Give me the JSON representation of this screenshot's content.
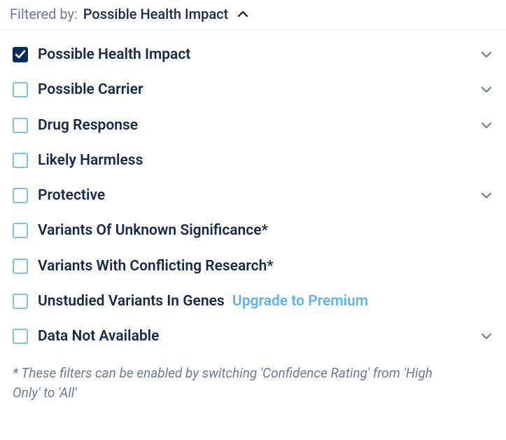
{
  "header": {
    "prefix": "Filtered by:",
    "value": "Possible Health Impact"
  },
  "filters": [
    {
      "label": "Possible Health Impact",
      "checked": true,
      "expandable": true
    },
    {
      "label": "Possible Carrier",
      "checked": false,
      "expandable": true
    },
    {
      "label": "Drug Response",
      "checked": false,
      "expandable": true
    },
    {
      "label": "Likely Harmless",
      "checked": false,
      "expandable": false
    },
    {
      "label": "Protective",
      "checked": false,
      "expandable": true
    },
    {
      "label": "Variants Of Unknown Significance*",
      "checked": false,
      "expandable": false
    },
    {
      "label": "Variants With Conflicting Research*",
      "checked": false,
      "expandable": false
    },
    {
      "label": "Unstudied Variants In Genes",
      "checked": false,
      "expandable": false,
      "upgrade": "Upgrade to Premium"
    },
    {
      "label": "Data Not Available",
      "checked": false,
      "expandable": true
    }
  ],
  "footnote": "* These filters can be enabled by switching 'Confidence Rating' from 'High Only' to 'All'",
  "colors": {
    "text": "#16294a",
    "muted": "#6b7b95",
    "checkboxBorder": "#7fc0ee",
    "checkboxChecked": "#0b2a5c",
    "link": "#5fb4e6"
  }
}
